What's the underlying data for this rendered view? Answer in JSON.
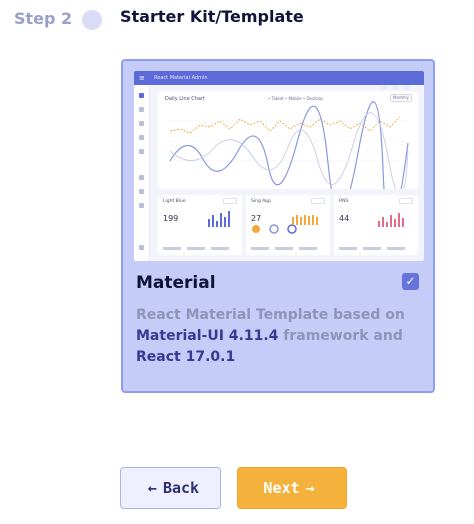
{
  "step": {
    "label": "Step 2",
    "title": "Starter Kit/Template"
  },
  "template_card": {
    "title": "Material",
    "selected": true,
    "description_prefix": "React Material Template based on",
    "description_highlight_1": "Material-UI 4.11.4",
    "description_middle": "framework and",
    "description_highlight_2": "React 17.0.1",
    "preview": {
      "app_title": "React Material Admin",
      "chart_title": "Daily Line Chart",
      "legend": "• Tablet  • Mobile  • Desktop",
      "select_label": "Monthly",
      "mini_cards": [
        {
          "title": "Light Blue",
          "value": "199"
        },
        {
          "title": "Sing App",
          "value": "27"
        },
        {
          "title": "RNS",
          "value": "44"
        }
      ]
    },
    "colors": {
      "card_bg": "#c5ccf7",
      "card_border": "#8f9ff0",
      "highlight_text": "#363a93"
    }
  },
  "buttons": {
    "back_arrow": "←",
    "back_label": "Back",
    "next_label": "Next",
    "next_arrow": "→",
    "next_color": "#f4b13c"
  },
  "icons": {
    "step_indicator": "circle-dot-icon",
    "check": "checkbox-checked-icon",
    "back": "arrow-left-icon",
    "next": "arrow-right-icon"
  }
}
